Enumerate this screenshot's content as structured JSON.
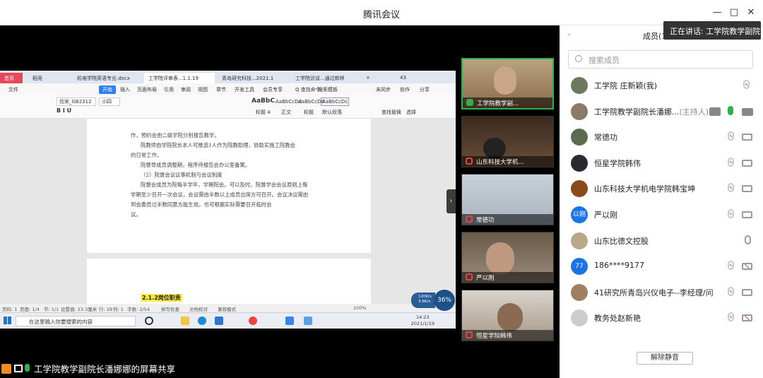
{
  "window": {
    "title": "腾讯会议"
  },
  "speaking": "正在讲话: 工学院教学副院...",
  "share_label": "工学院教学副院长潘娜娜的屏幕共享",
  "shared": {
    "tabs": [
      "首页",
      "稻壳",
      "机电学院英语专业.docx",
      "工学院评审表...1.1.19",
      "青岛研究科技...2021.1",
      "工学院访谈...通过郎林"
    ],
    "tab_count": "43",
    "menu": [
      "文件",
      "开始",
      "插入",
      "页面布局",
      "引用",
      "审阅",
      "视图",
      "章节",
      "开发工具",
      "会员专享",
      "Q 查找命令",
      "搜索模板",
      "未同步",
      "协作",
      "分享"
    ],
    "ribbon": {
      "font": "仿宋_GB2312",
      "size": "小四",
      "styles": [
        "AaBbC",
        "AaBbCcDd",
        "AaBbCcDd",
        "AaBbCcDc"
      ],
      "style_names": [
        "标题 4",
        "正文",
        "标题",
        "默认段落"
      ],
      "find": "查找替换",
      "select": "选择"
    },
    "doc_lines": [
      "作，预约会由二级学院分别报告教学。",
      "院教师由学院院长本人可推选1人作为院教助理，协助实施工院教会",
      "的日常工作。",
      "院督导成员调整期，程序待报告会办公室备案。",
      "（2）院督会议议事机制与会议制度",
      "院督会成员为院每半学年，学期院会。可以及时。院督学会会议原则上每",
      "学期至少召开一次会议，会议需由半数以上成员出席方可召开。会议决议需由",
      "到会委员过半数同意方能生效。也可根据实际需要召开临时会",
      "议。"
    ],
    "highlight": "2.1.2岗位职责",
    "status": [
      "页码: 1",
      "页面: 1/4",
      "节: 1/1",
      "设置值: 23.3厘米",
      "行: 29",
      "列: 1",
      "字数: 2/54",
      "拼写检查",
      "文档校对",
      "兼容模式"
    ],
    "zoom": "100%",
    "search_placeholder": "在这里输入你要搜索的内容",
    "clock_time": "14:23",
    "clock_date": "2021/1/19",
    "net": {
      "up": "120K/s",
      "down": "3.6K/s",
      "pct": "36%"
    }
  },
  "videos": [
    {
      "name": "工学院教学副..."
    },
    {
      "name": "山东科技大学机..."
    },
    {
      "name": "常德功"
    },
    {
      "name": "严以刚"
    },
    {
      "name": "恒星学院韩伟"
    }
  ],
  "panel": {
    "title": "成员(1",
    "search_placeholder": "搜索成员",
    "members": [
      {
        "name": "工学院 庄新颖(我)",
        "avatar": "",
        "color": "#6b7a5c",
        "status": "mic-muted"
      },
      {
        "name": "工学院教学副院长潘娜...",
        "host": "(主持人)",
        "avatar": "",
        "color": "#8a7a6c",
        "status": "sharing"
      },
      {
        "name": "常德功",
        "avatar": "",
        "color": "#5b6b4e",
        "status": "muted"
      },
      {
        "name": "恒星学院韩伟",
        "avatar": "",
        "color": "#2a2a30",
        "status": "muted"
      },
      {
        "name": "山东科技大学机电学院韩宝坤",
        "avatar": "",
        "color": "#8a4a1e",
        "status": "muted"
      },
      {
        "name": "严以刚",
        "avatar": "以刚",
        "color": "#1a73e8",
        "status": "muted"
      },
      {
        "name": "山东比德文控股",
        "avatar": "",
        "color": "#b8a88a",
        "status": "mic-only"
      },
      {
        "name": "186****9177",
        "avatar": "77",
        "color": "#1a73e8",
        "status": "muted-nocam"
      },
      {
        "name": "41研究所青岛兴仪电子--李经理/问...",
        "avatar": "",
        "color": "#a08060",
        "status": "muted"
      },
      {
        "name": "教务处赵新艳",
        "avatar": "",
        "color": "#cccccc",
        "status": "muted-nocam"
      }
    ],
    "unmute_label": "解除静音"
  }
}
